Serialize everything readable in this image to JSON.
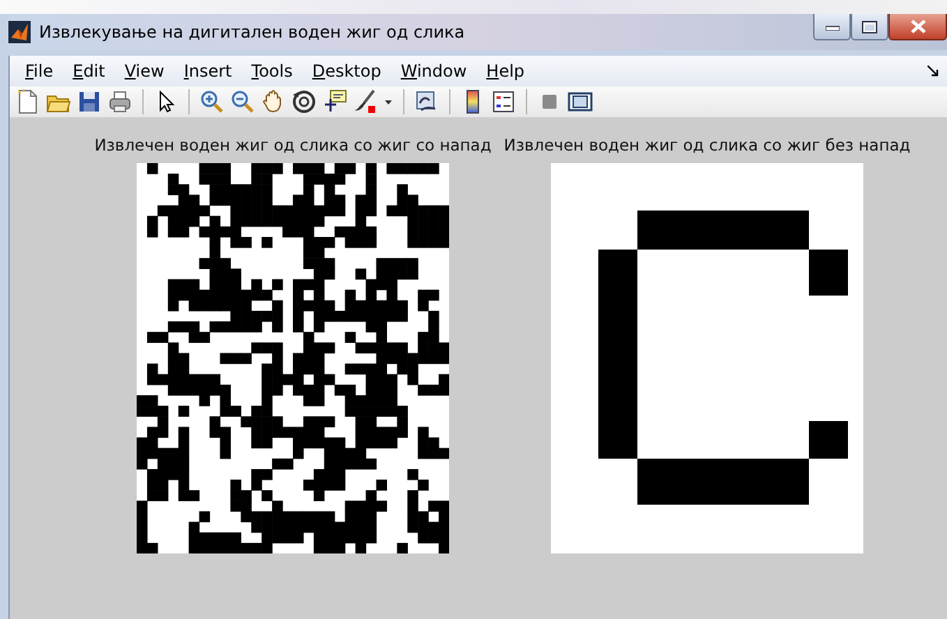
{
  "window": {
    "title": "Извлекување на дигитален воден жиг од слика"
  },
  "menu": [
    "File",
    "Edit",
    "View",
    "Insert",
    "Tools",
    "Desktop",
    "Window",
    "Help"
  ],
  "toolbar": [
    {
      "kind": "new"
    },
    {
      "kind": "open"
    },
    {
      "kind": "save"
    },
    {
      "kind": "print"
    },
    {
      "kind": "sep"
    },
    {
      "kind": "pointer"
    },
    {
      "kind": "sep"
    },
    {
      "kind": "zoomin"
    },
    {
      "kind": "zoomout"
    },
    {
      "kind": "pan"
    },
    {
      "kind": "rotate"
    },
    {
      "kind": "datacursor"
    },
    {
      "kind": "brush"
    },
    {
      "kind": "caret"
    },
    {
      "kind": "sep"
    },
    {
      "kind": "link"
    },
    {
      "kind": "sep"
    },
    {
      "kind": "colorbar"
    },
    {
      "kind": "legend"
    },
    {
      "kind": "sep"
    },
    {
      "kind": "square"
    },
    {
      "kind": "panel"
    }
  ],
  "plots": [
    {
      "title": "Извлечен воден жиг од слика со жиг со напад",
      "kind": "noise"
    },
    {
      "title": "Извлечен воден жиг од слика со жиг без напад",
      "kind": "letter"
    }
  ]
}
